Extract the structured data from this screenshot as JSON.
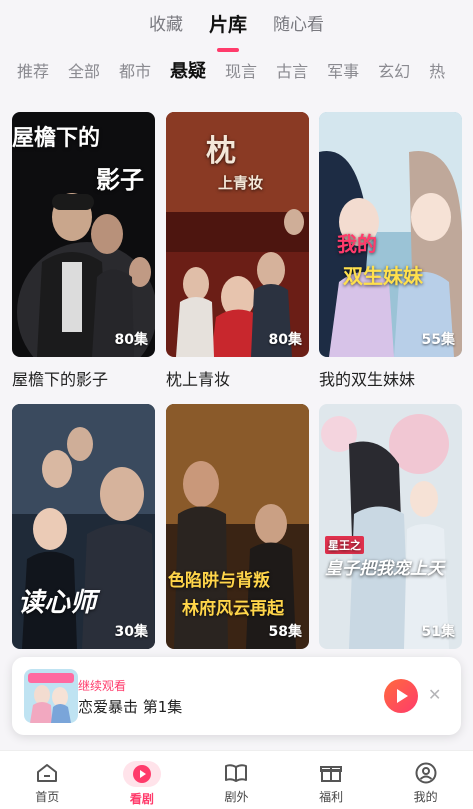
{
  "top_tabs": [
    {
      "label": "收藏"
    },
    {
      "label": "片库"
    },
    {
      "label": "随心看"
    }
  ],
  "genre_tabs": [
    {
      "label": "推荐"
    },
    {
      "label": "全部"
    },
    {
      "label": "都市"
    },
    {
      "label": "悬疑"
    },
    {
      "label": "现言"
    },
    {
      "label": "古言"
    },
    {
      "label": "军事"
    },
    {
      "label": "玄幻"
    },
    {
      "label": "热"
    }
  ],
  "dramas": [
    {
      "title": "屋檐下的影子",
      "episodes": "80集",
      "poster_line1": "屋檐下的",
      "poster_line2": "影子"
    },
    {
      "title": "枕上青妆",
      "episodes": "80集",
      "poster_line1": "枕",
      "poster_line2": "上青妆"
    },
    {
      "title": "我的双生妹妹",
      "episodes": "55集",
      "poster_line1": "我的",
      "poster_line2": "双生妹妹"
    },
    {
      "title": "",
      "episodes": "30集",
      "poster_line1": "读心师",
      "poster_line2": ""
    },
    {
      "title": "",
      "episodes": "58集",
      "poster_line1": "色陷阱与背叛",
      "poster_line2": "林府风云再起"
    },
    {
      "title": "",
      "episodes": "51集",
      "poster_line1": "皇子把我宠上天",
      "poster_line2": ""
    }
  ],
  "continue_watching": {
    "label": "继续观看",
    "title": "恋爱暴击 第1集"
  },
  "bottom_nav": [
    {
      "label": "首页",
      "icon": "home-icon"
    },
    {
      "label": "看剧",
      "icon": "play-icon"
    },
    {
      "label": "剧外",
      "icon": "book-icon"
    },
    {
      "label": "福利",
      "icon": "gift-icon"
    },
    {
      "label": "我的",
      "icon": "user-icon"
    }
  ],
  "colors": {
    "accent": "#ff3b6b",
    "accent_orange": "#ff8a3d"
  }
}
